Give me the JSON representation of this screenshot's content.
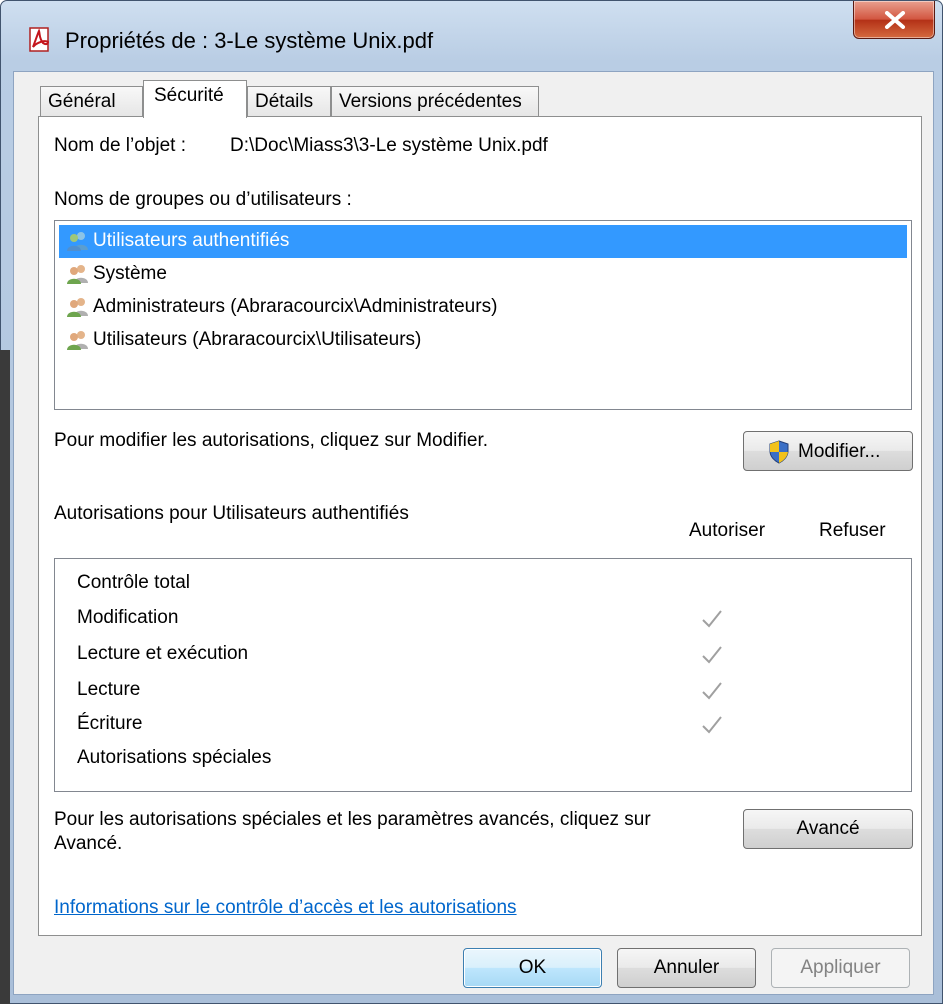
{
  "window": {
    "title": "Propriétés de : 3-Le système Unix.pdf",
    "icon": "pdf-file-icon",
    "close_glyph": "close-icon"
  },
  "tabs": [
    {
      "label": "Général",
      "active": false
    },
    {
      "label": "Sécurité",
      "active": true
    },
    {
      "label": "Détails",
      "active": false
    },
    {
      "label": "Versions précédentes",
      "active": false
    }
  ],
  "security": {
    "object_name_label": "Nom de l’objet :",
    "object_name_value": "D:\\Doc\\Miass3\\3-Le système Unix.pdf",
    "groups_label": "Noms de groupes ou d’utilisateurs :",
    "groups": [
      {
        "name": "Utilisateurs authentifiés",
        "selected": true
      },
      {
        "name": "Système",
        "selected": false
      },
      {
        "name": "Administrateurs (Abraracourcix\\Administrateurs)",
        "selected": false
      },
      {
        "name": "Utilisateurs (Abraracourcix\\Utilisateurs)",
        "selected": false
      }
    ],
    "modify_hint": "Pour modifier les autorisations, cliquez sur Modifier.",
    "modify_button": "Modifier...",
    "permissions_for": "Autorisations pour Utilisateurs authentifiés",
    "allow_header": "Autoriser",
    "deny_header": "Refuser",
    "permissions": [
      {
        "name": "Contrôle total",
        "allow": false,
        "deny": false
      },
      {
        "name": "Modification",
        "allow": true,
        "deny": false
      },
      {
        "name": "Lecture et exécution",
        "allow": true,
        "deny": false
      },
      {
        "name": "Lecture",
        "allow": true,
        "deny": false
      },
      {
        "name": "Écriture",
        "allow": true,
        "deny": false
      },
      {
        "name": "Autorisations spéciales",
        "allow": false,
        "deny": false
      }
    ],
    "advanced_hint_line1": "Pour les autorisations spéciales et les paramètres avancés, cliquez sur",
    "advanced_hint_line2": "Avancé.",
    "advanced_button": "Avancé",
    "info_link": "Informations sur le contrôle d’accès et les autorisations"
  },
  "footer": {
    "ok": "OK",
    "cancel": "Annuler",
    "apply": "Appliquer"
  },
  "colors": {
    "selection": "#3399ff",
    "link": "#0066cc",
    "check": "#a0a0a0"
  }
}
